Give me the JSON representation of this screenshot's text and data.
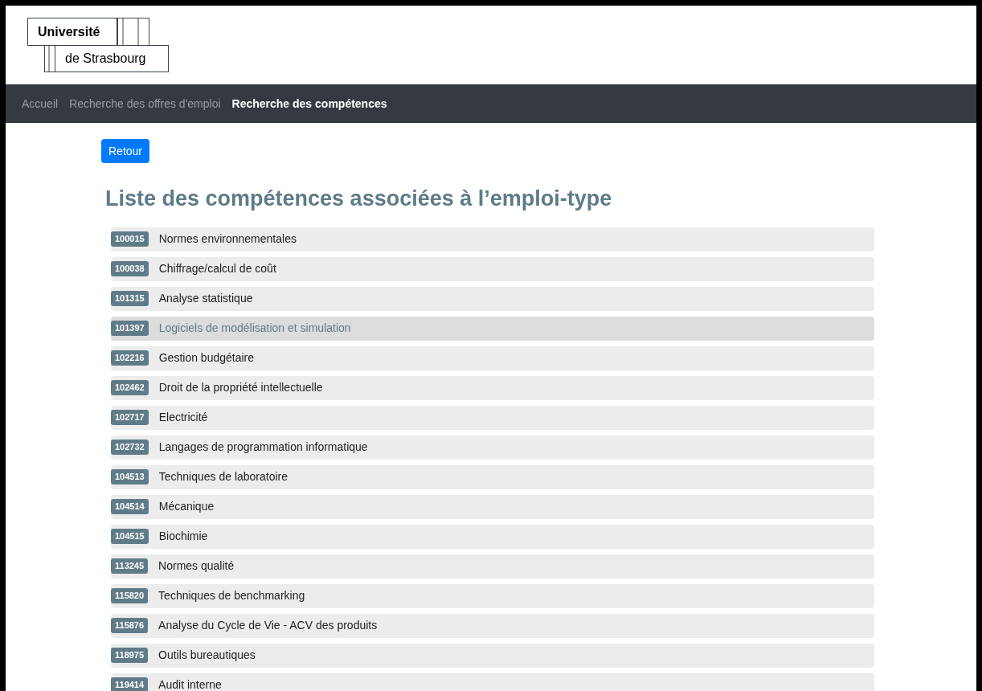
{
  "logo": {
    "line_1": "Université",
    "line_2": "de Strasbourg"
  },
  "nav": [
    {
      "label": "Accueil",
      "selected": false
    },
    {
      "label": "Recherche des offres d'emploi",
      "selected": false
    },
    {
      "label": "Recherche des compétences",
      "selected": true
    }
  ],
  "back_button": "Retour",
  "heading": "Liste des compétences associées à l’emploi-type",
  "skills": [
    {
      "code": "100015",
      "label": "Normes environnementales",
      "highlighted": false
    },
    {
      "code": "100038",
      "label": "Chiffrage/calcul de coût",
      "highlighted": false
    },
    {
      "code": "101315",
      "label": "Analyse statistique",
      "highlighted": false
    },
    {
      "code": "101397",
      "label": "Logiciels de modélisation et simulation",
      "highlighted": true
    },
    {
      "code": "102216",
      "label": "Gestion budgétaire",
      "highlighted": false
    },
    {
      "code": "102462",
      "label": "Droit de la propriété intellectuelle",
      "highlighted": false
    },
    {
      "code": "102717",
      "label": "Electricité",
      "highlighted": false
    },
    {
      "code": "102732",
      "label": "Langages de programmation informatique",
      "highlighted": false
    },
    {
      "code": "104513",
      "label": "Techniques de laboratoire",
      "highlighted": false
    },
    {
      "code": "104514",
      "label": "Mécanique",
      "highlighted": false
    },
    {
      "code": "104515",
      "label": "Biochimie",
      "highlighted": false
    },
    {
      "code": "113245",
      "label": "Normes qualité",
      "highlighted": false
    },
    {
      "code": "115820",
      "label": "Techniques de benchmarking",
      "highlighted": false
    },
    {
      "code": "115876",
      "label": "Analyse du Cycle de Vie - ACV des produits",
      "highlighted": false
    },
    {
      "code": "118975",
      "label": "Outils bureautiques",
      "highlighted": false
    },
    {
      "code": "119414",
      "label": "Audit interne",
      "highlighted": false
    }
  ]
}
